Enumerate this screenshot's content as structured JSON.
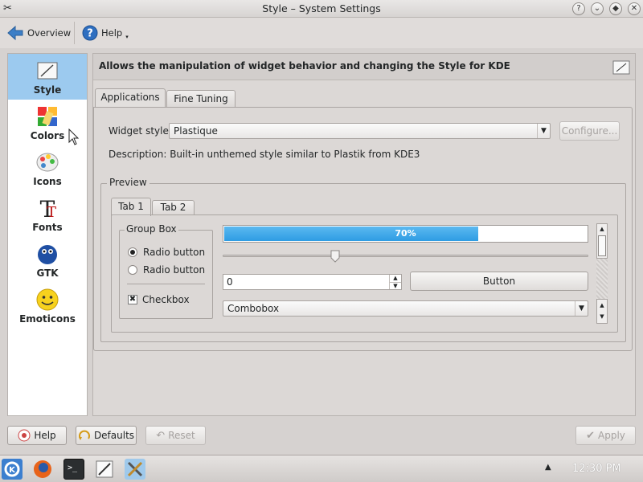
{
  "window": {
    "title": "Style – System Settings",
    "buttons": [
      "?",
      "⌄",
      "◆",
      "✕"
    ]
  },
  "toolbar": {
    "overview_label": "Overview",
    "help_label": "Help"
  },
  "sidebar": {
    "items": [
      {
        "label": "Style",
        "icon": "style-icon"
      },
      {
        "label": "Colors",
        "icon": "colors-icon"
      },
      {
        "label": "Icons",
        "icon": "icons-icon"
      },
      {
        "label": "Fonts",
        "icon": "fonts-icon"
      },
      {
        "label": "GTK",
        "icon": "gtk-icon"
      },
      {
        "label": "Emoticons",
        "icon": "emoticons-icon"
      }
    ]
  },
  "header": {
    "text": "Allows the manipulation of widget behavior and changing the Style for KDE"
  },
  "tabs": {
    "applications": "Applications",
    "fine_tuning": "Fine Tuning"
  },
  "widget_style": {
    "label": "Widget style:",
    "value": "Plastique",
    "configure_label": "Configure...",
    "description": "Description: Built-in unthemed style similar to Plastik from KDE3"
  },
  "preview": {
    "title": "Preview",
    "tab1": "Tab 1",
    "tab2": "Tab 2",
    "group_box_title": "Group Box",
    "radio1": "Radio button",
    "radio2": "Radio button",
    "checkbox": "Checkbox",
    "progress_text": "70%",
    "progress_value": 0.7,
    "spinbox_value": "0",
    "button_label": "Button",
    "combobox_value": "Combobox"
  },
  "bottom": {
    "help_label": "Help",
    "defaults_label": "Defaults",
    "reset_label": "Reset",
    "apply_label": "Apply"
  },
  "taskbar": {
    "clock": "12:30 PM"
  },
  "colors": {
    "accent": "#3daee9",
    "selection": "#9ccaef"
  }
}
